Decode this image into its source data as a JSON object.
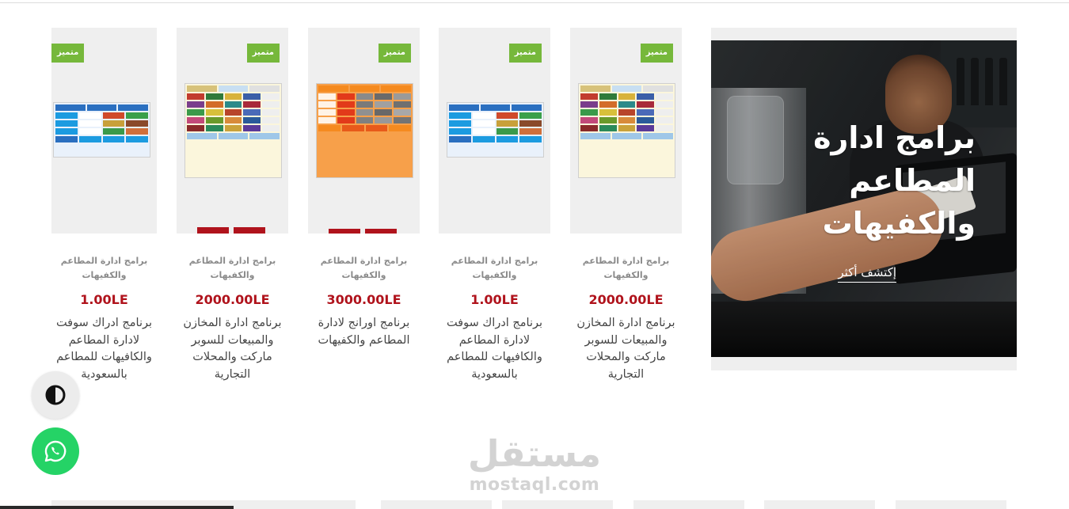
{
  "banner": {
    "title": "برامج ادارة المطاعم والكفيهات",
    "link": "إكتشف أكثر"
  },
  "products": [
    {
      "badge": "متميز",
      "category": "برامج ادارة المطاعم والكفيهات",
      "price": "2000.00LE",
      "name": "برنامج ادارة المخازن والمبيعات للسوبر ماركت والمحلات التجارية"
    },
    {
      "badge": "متميز",
      "category": "برامج ادارة المطاعم والكفيهات",
      "price": "1.00LE",
      "name": "برنامج ادراك سوفت لادارة المطاعم والكافيهات للمطاعم بالسعودية"
    },
    {
      "badge": "متميز",
      "category": "برامج ادارة المطاعم والكفيهات",
      "price": "3000.00LE",
      "name": "برنامج اورانج لادارة المطاعم والكفيهات"
    },
    {
      "badge": "متميز",
      "category": "برامج ادارة المطاعم والكفيهات",
      "price": "2000.00LE",
      "name": "برنامج ادارة المخازن والمبيعات للسوبر ماركت والمحلات التجارية"
    },
    {
      "badge": "متميز",
      "category": "برامج ادارة المطاعم والكفيهات",
      "price": "1.00LE",
      "name": "برنامج ادراك سوفت لادارة المطاعم والكافيهات للمطاعم بالسعودية"
    }
  ],
  "watermark": {
    "arabic": "مستقل",
    "latin": "mostaql.com"
  },
  "icons": {
    "contrast": "contrast-icon",
    "whatsapp": "whatsapp-icon"
  },
  "colors": {
    "badge": "#76b83b",
    "price": "#b0131c",
    "whatsapp": "#25d366"
  }
}
